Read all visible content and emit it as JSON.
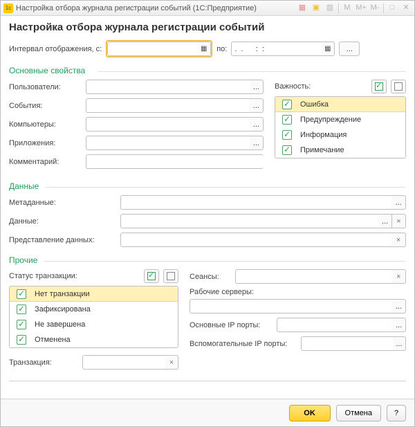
{
  "window": {
    "title": "Настройка отбора журнала регистрации событий  (1С:Предприятие)"
  },
  "page_title": "Настройка отбора журнала регистрации событий",
  "interval": {
    "label": "Интервал отображения, с:",
    "from_value": "",
    "to_label": "по:",
    "to_value": ".  .      :  :",
    "more": "..."
  },
  "sections": {
    "main": "Основные свойства",
    "data": "Данные",
    "other": "Прочие"
  },
  "main_fields": {
    "users": "Пользователи:",
    "events": "События:",
    "computers": "Компьютеры:",
    "apps": "Приложения:",
    "comment": "Комментарий:"
  },
  "importance": {
    "label": "Важность:",
    "items": [
      "Ошибка",
      "Предупреждение",
      "Информация",
      "Примечание"
    ]
  },
  "data_fields": {
    "metadata": "Метаданные:",
    "data": "Данные:",
    "repr": "Представление данных:"
  },
  "other_fields": {
    "trans_status": "Статус транзакции:",
    "trans_items": [
      "Нет транзакции",
      "Зафиксирована",
      "Не завершена",
      "Отменена"
    ],
    "transaction": "Транзакция:",
    "sessions": "Сеансы:",
    "work_servers": "Рабочие серверы:",
    "main_ports": "Основные IP порты:",
    "aux_ports": "Вспомогательные IP порты:"
  },
  "footer": {
    "ok": "OK",
    "cancel": "Отмена",
    "help": "?"
  },
  "titlebar_icons": [
    "M",
    "M+",
    "M-"
  ]
}
